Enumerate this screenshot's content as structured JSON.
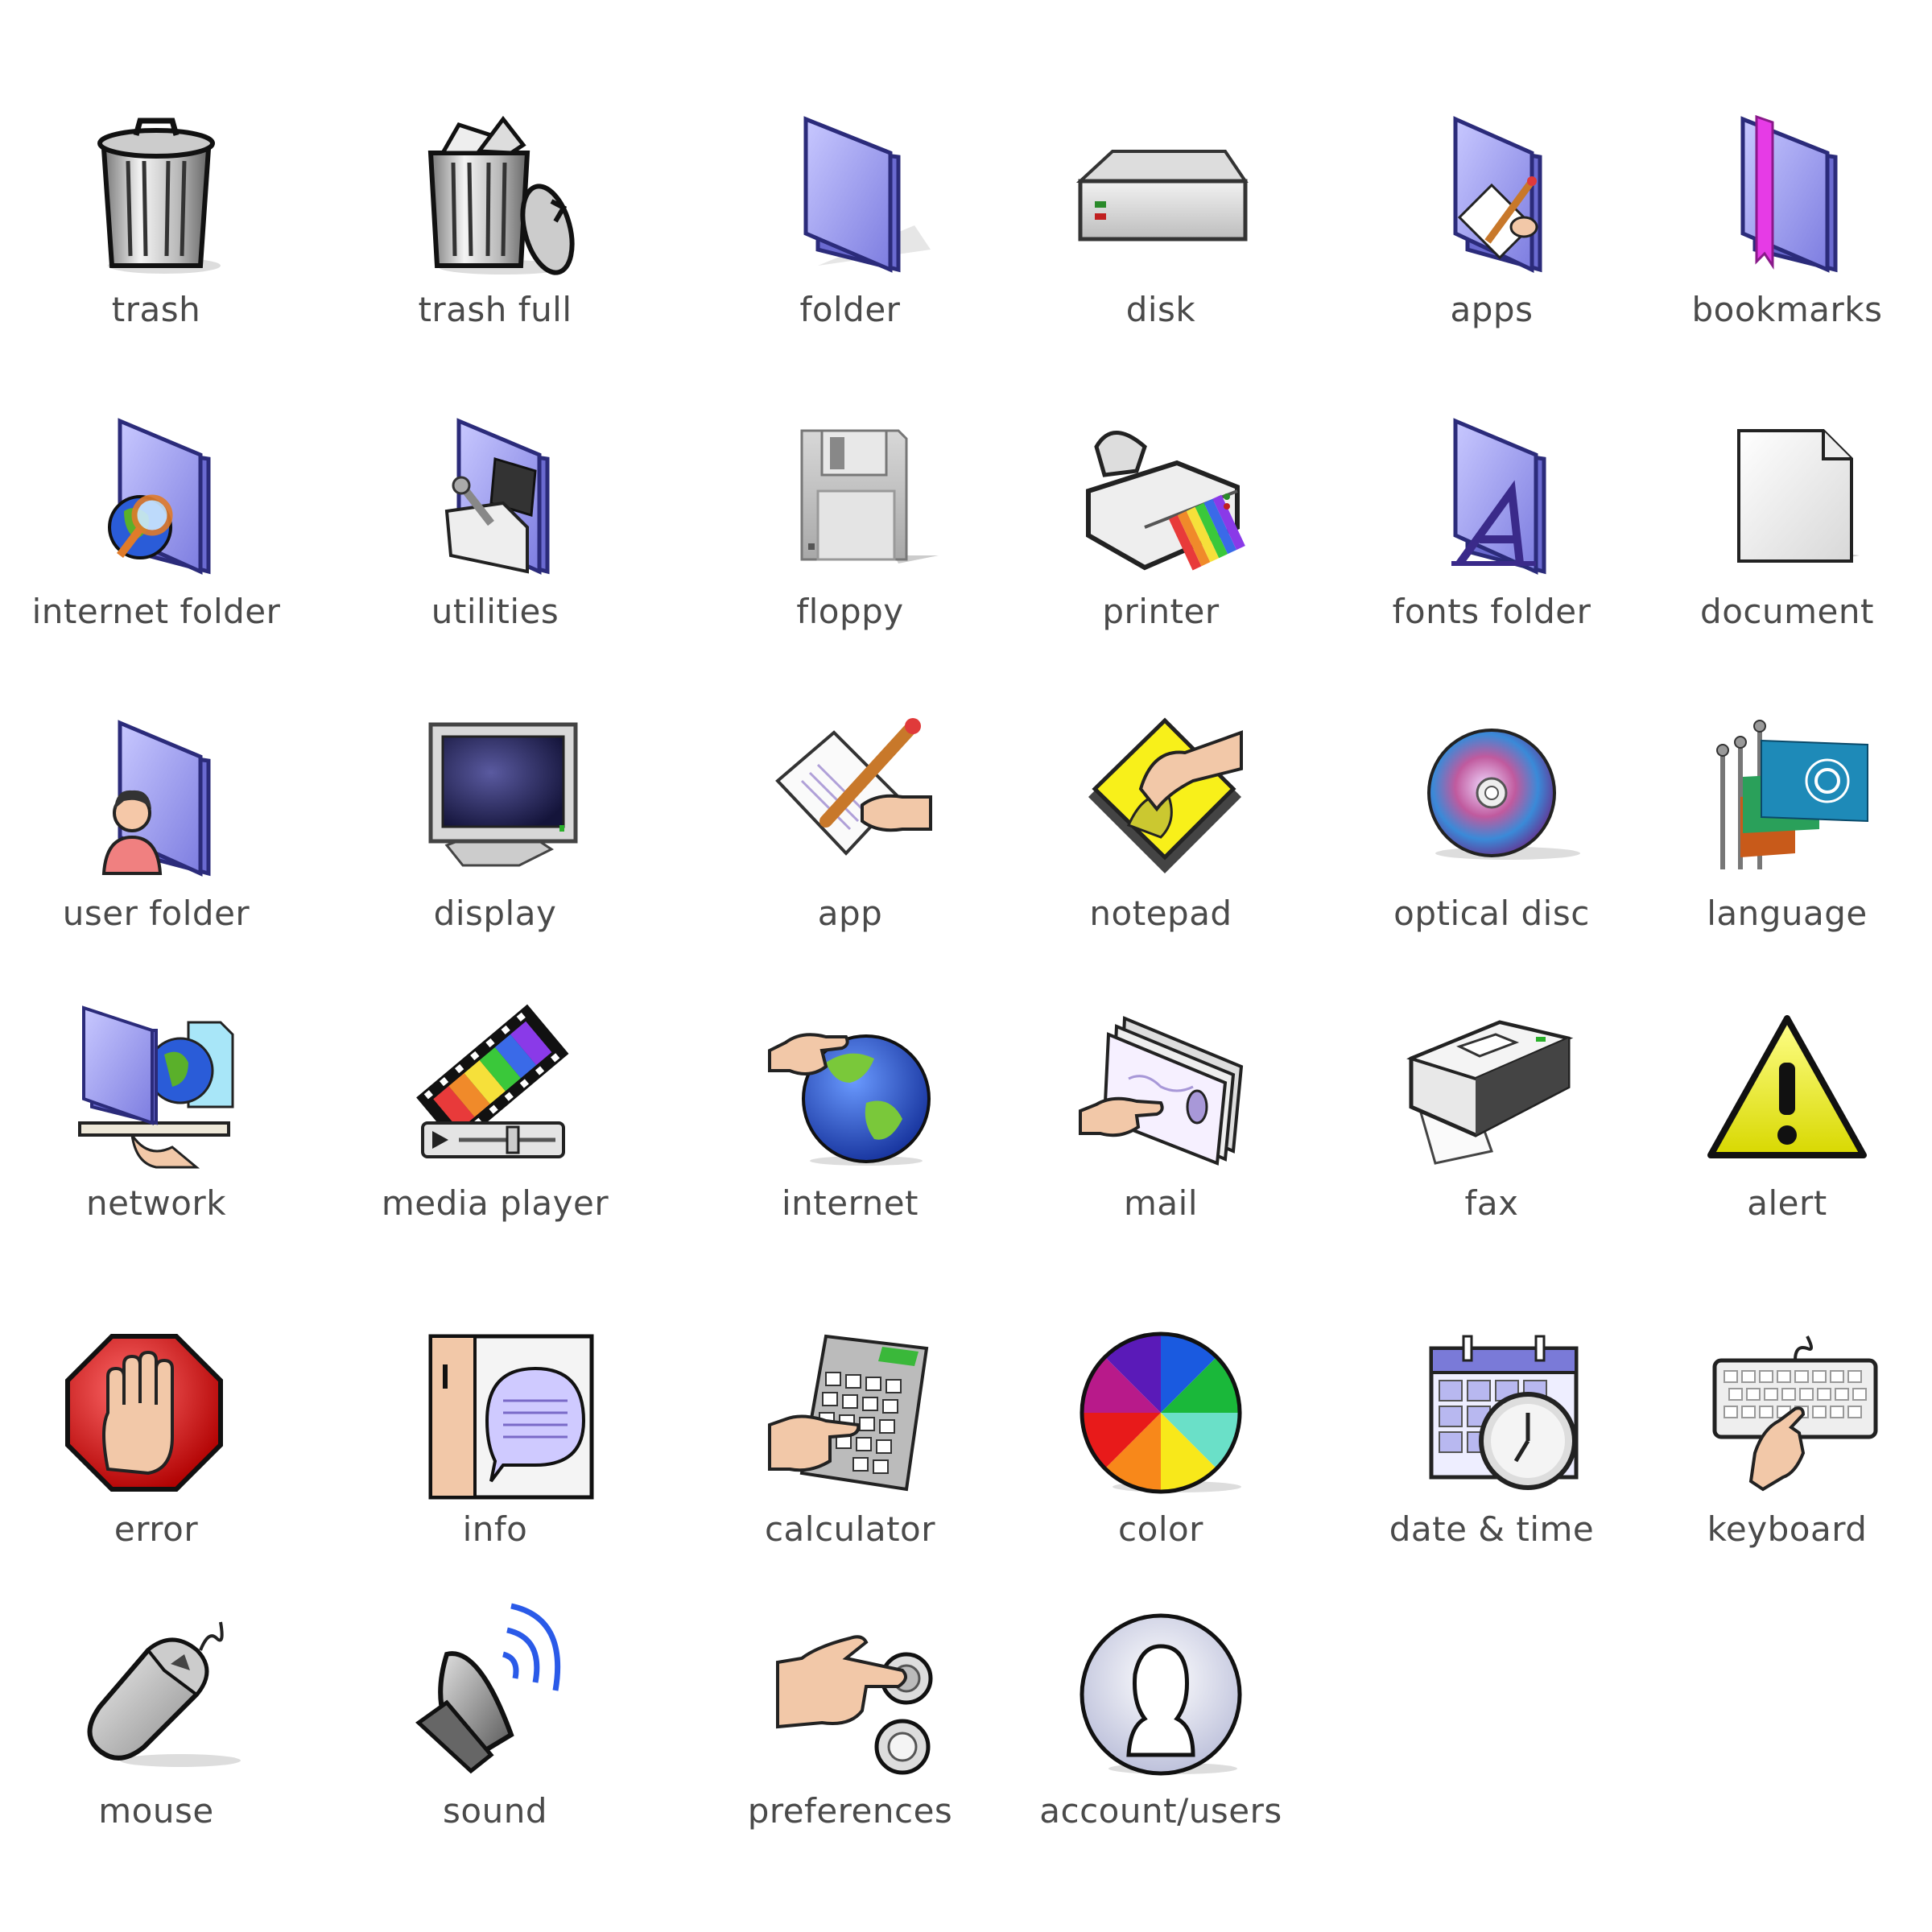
{
  "icons": [
    {
      "name": "trash-icon",
      "label": "trash"
    },
    {
      "name": "trash-full-icon",
      "label": "trash full"
    },
    {
      "name": "folder-icon",
      "label": "folder"
    },
    {
      "name": "disk-icon",
      "label": "disk"
    },
    {
      "name": "apps-icon",
      "label": "apps"
    },
    {
      "name": "bookmarks-icon",
      "label": "bookmarks"
    },
    {
      "name": "internet-folder-icon",
      "label": "internet folder"
    },
    {
      "name": "utilities-icon",
      "label": "utilities"
    },
    {
      "name": "floppy-icon",
      "label": "floppy"
    },
    {
      "name": "printer-icon",
      "label": "printer"
    },
    {
      "name": "fonts-folder-icon",
      "label": "fonts folder"
    },
    {
      "name": "document-icon",
      "label": "document"
    },
    {
      "name": "user-folder-icon",
      "label": "user folder"
    },
    {
      "name": "display-icon",
      "label": "display"
    },
    {
      "name": "app-icon",
      "label": "app"
    },
    {
      "name": "notepad-icon",
      "label": "notepad"
    },
    {
      "name": "optical-disc-icon",
      "label": "optical disc"
    },
    {
      "name": "language-icon",
      "label": "language"
    },
    {
      "name": "network-icon",
      "label": "network"
    },
    {
      "name": "media-player-icon",
      "label": "media player"
    },
    {
      "name": "internet-icon",
      "label": "internet"
    },
    {
      "name": "mail-icon",
      "label": "mail"
    },
    {
      "name": "fax-icon",
      "label": "fax"
    },
    {
      "name": "alert-icon",
      "label": "alert"
    },
    {
      "name": "error-icon",
      "label": "error"
    },
    {
      "name": "info-icon",
      "label": "info"
    },
    {
      "name": "calculator-icon",
      "label": "calculator"
    },
    {
      "name": "color-icon",
      "label": "color"
    },
    {
      "name": "date-time-icon",
      "label": "date & time"
    },
    {
      "name": "keyboard-icon",
      "label": "keyboard"
    },
    {
      "name": "mouse-icon",
      "label": "mouse"
    },
    {
      "name": "sound-icon",
      "label": "sound"
    },
    {
      "name": "preferences-icon",
      "label": "preferences"
    },
    {
      "name": "account-users-icon",
      "label": "account/users"
    }
  ],
  "colors": {
    "folder": "#8e8ee6",
    "folder_dark": "#5a5ab8",
    "label": "#4a4a4a"
  }
}
